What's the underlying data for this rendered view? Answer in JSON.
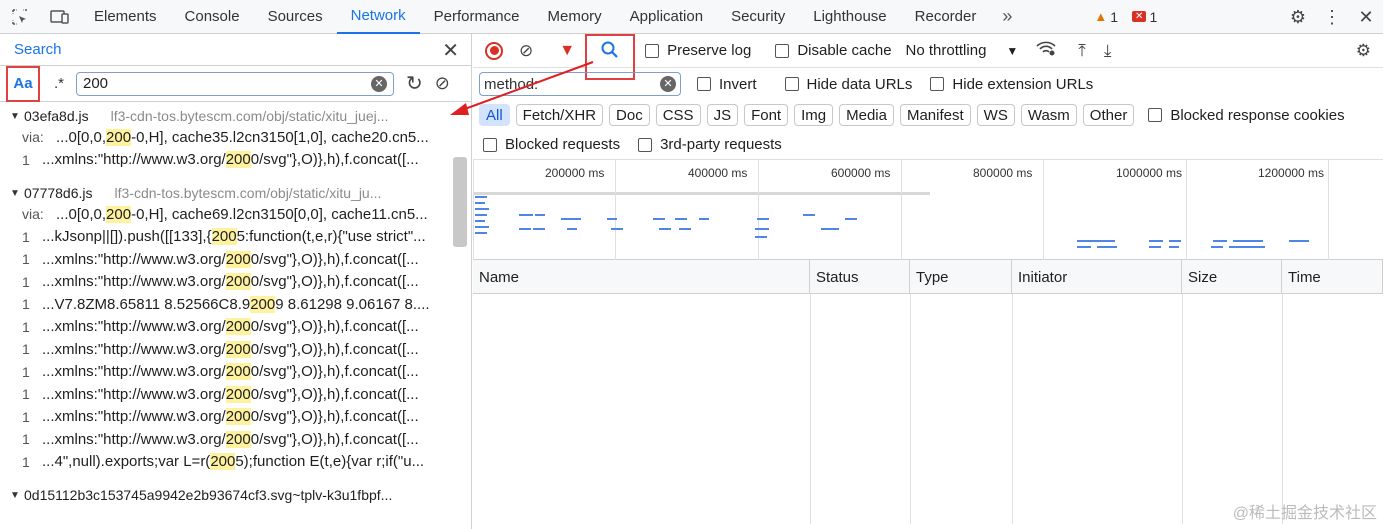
{
  "topbar": {
    "tabs": [
      "Elements",
      "Console",
      "Sources",
      "Network",
      "Performance",
      "Memory",
      "Application",
      "Security",
      "Lighthouse",
      "Recorder"
    ],
    "active_tab": "Network",
    "more": "»",
    "warn_count": "1",
    "error_count": "1"
  },
  "search": {
    "title": "Search",
    "case_label": "Aa",
    "regex_label": ".*",
    "query": "200"
  },
  "results": [
    {
      "file": "03efa8d.js",
      "url": "lf3-cdn-tos.bytescm.com/obj/static/xitu_juej...",
      "lines": [
        {
          "ln": "via:",
          "pre": "...0[0,0,",
          "match": "200",
          "post": "-0,H], cache35.l2cn3150[1,0], cache20.cn5..."
        },
        {
          "ln": "1",
          "pre": "...xmlns:\"http://www.w3.org/",
          "match": "200",
          "post": "0/svg\"},O)},h),f.concat([..."
        }
      ]
    },
    {
      "file": "07778d6.js",
      "url": "lf3-cdn-tos.bytescm.com/obj/static/xitu_ju...",
      "lines": [
        {
          "ln": "via:",
          "pre": "...0[0,0,",
          "match": "200",
          "post": "-0,H], cache69.l2cn3150[0,0], cache11.cn5..."
        },
        {
          "ln": "1",
          "pre": "...kJsonp||[]).push([[133],{",
          "match": "200",
          "post": "5:function(t,e,r){\"use strict\"..."
        },
        {
          "ln": "1",
          "pre": "...xmlns:\"http://www.w3.org/",
          "match": "200",
          "post": "0/svg\"},O)},h),f.concat([..."
        },
        {
          "ln": "1",
          "pre": "...xmlns:\"http://www.w3.org/",
          "match": "200",
          "post": "0/svg\"},O)},h),f.concat([..."
        },
        {
          "ln": "1",
          "pre": "...V7.8ZM8.65811 8.52566C8.9",
          "match": "200",
          "post": "9 8.61298 9.06167 8...."
        },
        {
          "ln": "1",
          "pre": "...xmlns:\"http://www.w3.org/",
          "match": "200",
          "post": "0/svg\"},O)},h),f.concat([..."
        },
        {
          "ln": "1",
          "pre": "...xmlns:\"http://www.w3.org/",
          "match": "200",
          "post": "0/svg\"},O)},h),f.concat([..."
        },
        {
          "ln": "1",
          "pre": "...xmlns:\"http://www.w3.org/",
          "match": "200",
          "post": "0/svg\"},O)},h),f.concat([..."
        },
        {
          "ln": "1",
          "pre": "...xmlns:\"http://www.w3.org/",
          "match": "200",
          "post": "0/svg\"},O)},h),f.concat([..."
        },
        {
          "ln": "1",
          "pre": "...xmlns:\"http://www.w3.org/",
          "match": "200",
          "post": "0/svg\"},O)},h),f.concat([..."
        },
        {
          "ln": "1",
          "pre": "...xmlns:\"http://www.w3.org/",
          "match": "200",
          "post": "0/svg\"},O)},h),f.concat([..."
        },
        {
          "ln": "1",
          "pre": "...4\",null).exports;var L=r(",
          "match": "200",
          "post": "5);function E(t,e){var r;if(\"u..."
        }
      ]
    },
    {
      "file": "0d15112b3c153745a9942e2b93674cf3.svg~tplv-k3u1fbpf...",
      "url": "",
      "lines": []
    }
  ],
  "network": {
    "preserve_log": "Preserve log",
    "disable_cache": "Disable cache",
    "throttling": "No throttling",
    "filter_value": "method:",
    "invert": "Invert",
    "hide_data_urls": "Hide data URLs",
    "hide_ext_urls": "Hide extension URLs",
    "type_filters": [
      "All",
      "Fetch/XHR",
      "Doc",
      "CSS",
      "JS",
      "Font",
      "Img",
      "Media",
      "Manifest",
      "WS",
      "Wasm",
      "Other"
    ],
    "blocked_cookies": "Blocked response cookies",
    "blocked_requests": "Blocked requests",
    "third_party": "3rd-party requests",
    "timeline_ticks": [
      "200000 ms",
      "400000 ms",
      "600000 ms",
      "800000 ms",
      "1000000 ms",
      "1200000 ms"
    ],
    "columns": [
      "Name",
      "Status",
      "Type",
      "Initiator",
      "Size",
      "Time"
    ]
  },
  "watermark": "@稀土掘金技术社区"
}
